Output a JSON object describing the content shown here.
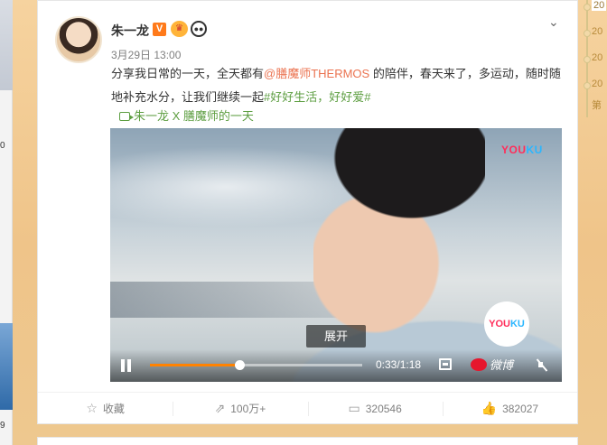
{
  "left_strip": {
    "num1": "0",
    "num2": "9"
  },
  "timeline": {
    "years": [
      "20",
      "20",
      "20",
      "20"
    ],
    "current_year": "20",
    "more": "第"
  },
  "post": {
    "author": "朱一龙",
    "verified_badge": "V",
    "time": "3月29日 13:00",
    "text_prefix": "分享我日常的一天，全天都有",
    "mention": "@膳魔师THERMOS",
    "text_middle": " 的陪伴，春天来了，多运动，随时随地补充水分，让我们继续一起",
    "hashtag": "#好好生活，好好爱#",
    "video_link": "朱一龙 X 膳魔师的一天",
    "more_icon": "chevron-down-icon"
  },
  "video": {
    "watermark_top": [
      "YOU",
      "KU"
    ],
    "watermark_circle": [
      "YOU",
      "KU"
    ],
    "expand_label": "展开",
    "current_time": "0:33",
    "duration": "1:18",
    "time_text": "0:33/1:18",
    "progress": 0.423,
    "weibo_label": "微博"
  },
  "footer": {
    "favorite": "收藏",
    "repost": "100万+",
    "comment": "320546",
    "like": "382027"
  }
}
